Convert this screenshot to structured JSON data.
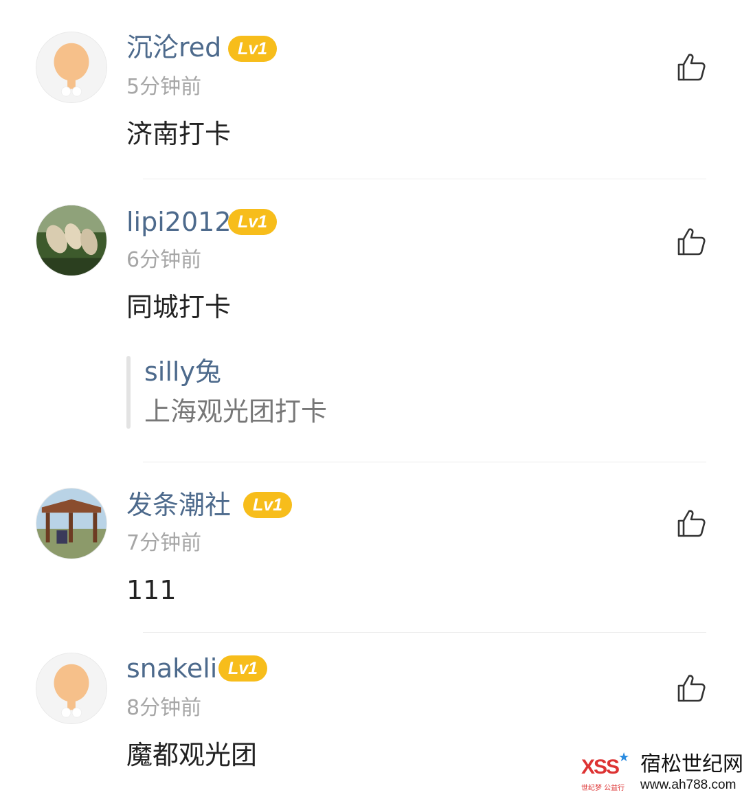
{
  "comments": [
    {
      "username": "沉沦red",
      "level": "Lv1",
      "time": "5分钟前",
      "text": "济南打卡",
      "avatar": "default-chicken-avatar-icon"
    },
    {
      "username": "lipi2012",
      "level": "Lv1",
      "time": "6分钟前",
      "text": "同城打卡",
      "avatar": "photo-avatar-reeds",
      "reply": {
        "username": "silly兔",
        "text": "上海观光团打卡"
      }
    },
    {
      "username": "发条潮社",
      "level": "Lv1",
      "time": "7分钟前",
      "text": "111",
      "avatar": "photo-avatar-pavilion"
    },
    {
      "username": "snakeli",
      "level": "Lv1",
      "time": "8分钟前",
      "text": "魔都观光团",
      "avatar": "default-chicken-avatar-icon"
    }
  ],
  "like_icon": "thumbs-up-icon",
  "watermark": {
    "logo_text": "XSS",
    "sub_text": "世纪梦 公益行",
    "site_name": "宿松世纪网",
    "site_url": "www.ah788.com"
  },
  "colors": {
    "username": "#4d6a8c",
    "level_badge": "#f7bd1b",
    "time": "#a6a6a6",
    "text": "#222222"
  }
}
